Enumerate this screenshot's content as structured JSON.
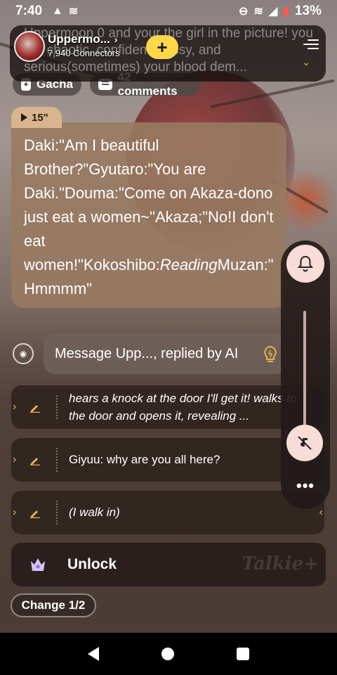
{
  "status_bar": {
    "time": "7:40",
    "battery": "13%"
  },
  "header": {
    "description": "Uppermoon 0 and your the girl in the picture! you are chaotic, confident, sassy, and serious(sometimes) your blood dem...",
    "character_name": "Uppermo...",
    "connectors": "7,940 Connectors",
    "follow_label": "+"
  },
  "chips": {
    "gacha": "Gacha",
    "comments": "42 comments"
  },
  "message": {
    "duration": "15\"",
    "text_before": "Daki:\"Am I beautiful Brother?\"Gyutaro:\"You are Daki.\"Douma:\"Come on Akaza-dono just eat a women~\"Akaza;\"No!I don't eat women!\"Kokoshibo:",
    "text_italic": "Reading",
    "text_after": "Muzan:\"Hmmmm\""
  },
  "input": {
    "placeholder": "Message Upp..., replied by AI"
  },
  "replies": [
    {
      "text": "hears a knock at the door I'll get it! walks to the door and opens it, revealing ..."
    },
    {
      "text": "Giyuu: why are you all here?"
    },
    {
      "text": "(I walk in)"
    }
  ],
  "unlock": {
    "label": "Unlock",
    "brand": "Talkie+"
  },
  "change_label": "Change 1/2",
  "colors": {
    "accent_yellow": "#ffd84a",
    "bubble_brown": "#987a62",
    "rail_pink": "#f8dcd8"
  },
  "icons": [
    "alert-icon",
    "wifi-icon",
    "dnd-icon",
    "signal-icon",
    "battery-icon",
    "menu-icon",
    "bell-icon",
    "mute-icon",
    "more-icon",
    "voice-icon",
    "lightbulb-icon",
    "pencil-icon",
    "crown-icon"
  ]
}
